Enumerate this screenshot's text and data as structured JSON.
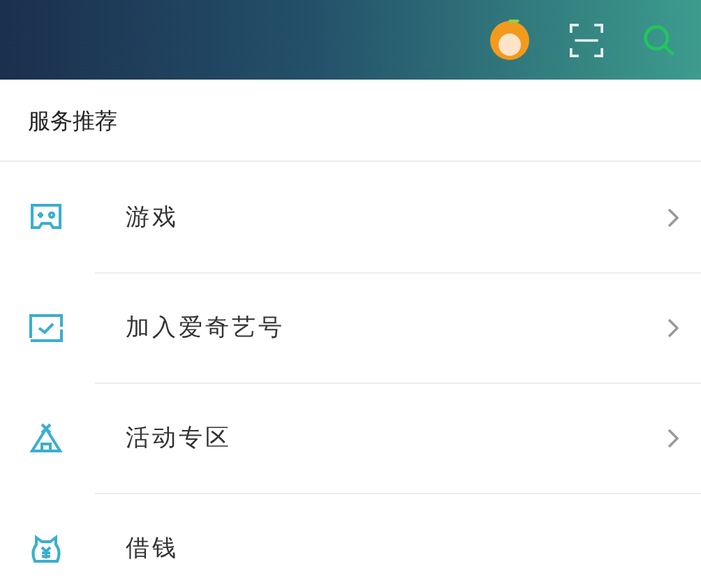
{
  "section": {
    "title": "服务推荐"
  },
  "items": [
    {
      "label": "游戏",
      "arrow": true
    },
    {
      "label": "加入爱奇艺号",
      "arrow": true
    },
    {
      "label": "活动专区",
      "arrow": true
    },
    {
      "label": "借钱",
      "arrow": false
    }
  ]
}
